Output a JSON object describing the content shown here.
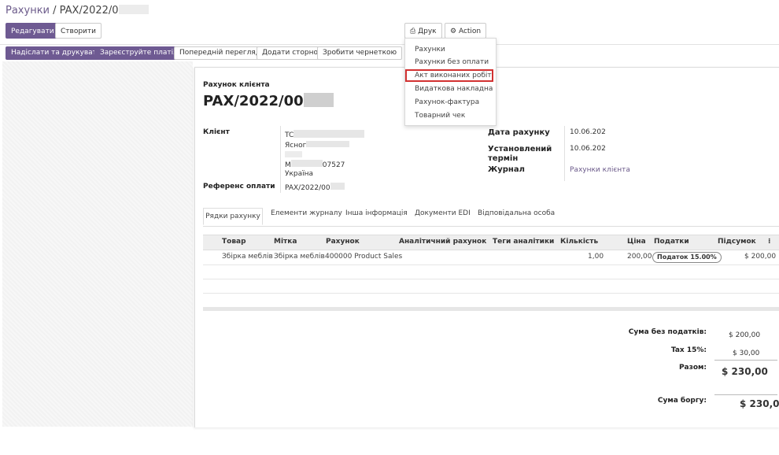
{
  "breadcrumb": {
    "parent": "Рахунки",
    "separator": " / ",
    "current": "PAX/2022/0"
  },
  "toolbar": {
    "edit": "Редагувати",
    "create": "Створити",
    "print": "Друк",
    "action": "Action"
  },
  "status_bar": {
    "send_print": "Надіслати та друкувати",
    "register_payment": "Зареєструйте платіж",
    "preview": "Попередній перегляд",
    "add_reversal": "Додати сторно",
    "to_draft": "Зробити чернеткою"
  },
  "print_menu": {
    "items": [
      "Рахунки",
      "Рахунки без оплати",
      "Акт виконаних робіт",
      "Видаткова накладна",
      "Рахунок-фактура",
      "Товарний чек"
    ],
    "highlighted_index": 2,
    "highlight_color": "#d23131"
  },
  "invoice": {
    "type_label": "Рахунок клієнта",
    "number": "PAX/2022/00",
    "customer_label": "Клієнт",
    "customer_lines": [
      "TC",
      "Ясног",
      "",
      "М",
      "Україна"
    ],
    "customer_partial": "07527",
    "payment_ref_label": "Референс оплати",
    "payment_ref": "PAX/2022/00",
    "invoice_date_label": "Дата рахунку",
    "invoice_date": "10.06.202",
    "due_date_label": "Установлений термін",
    "due_date": "10.06.202",
    "journal_label": "Журнал",
    "journal": "Рахунки клієнта"
  },
  "tabs": [
    "Рядки рахунку",
    "Елементи журналу",
    "Інша інформація",
    "Документи EDI",
    "Відповідальна особа"
  ],
  "table": {
    "columns": [
      "Товар",
      "Мітка",
      "Рахунок",
      "Аналітичний рахунок",
      "Теги аналітики",
      "Кількість",
      "Ціна",
      "Податки",
      "Підсумок"
    ],
    "rows": [
      {
        "product": "Збірка меблів",
        "label": "Збірка меблів",
        "account": "400000 Product Sales",
        "analytic": "",
        "tags": "",
        "qty": "1,00",
        "price": "200,00",
        "tax": "Податок 15.00%",
        "subtotal": "$ 200,00"
      }
    ]
  },
  "totals": {
    "untaxed_label": "Сума без податків:",
    "untaxed": "$ 200,00",
    "tax_label": "Tax 15%:",
    "tax": "$ 30,00",
    "total_label": "Разом:",
    "total": "$ 230,00",
    "due_label": "Сума боргу:",
    "due": "$ 230,00"
  },
  "colors": {
    "primary": "#6e5a92",
    "highlight": "#d23131"
  }
}
